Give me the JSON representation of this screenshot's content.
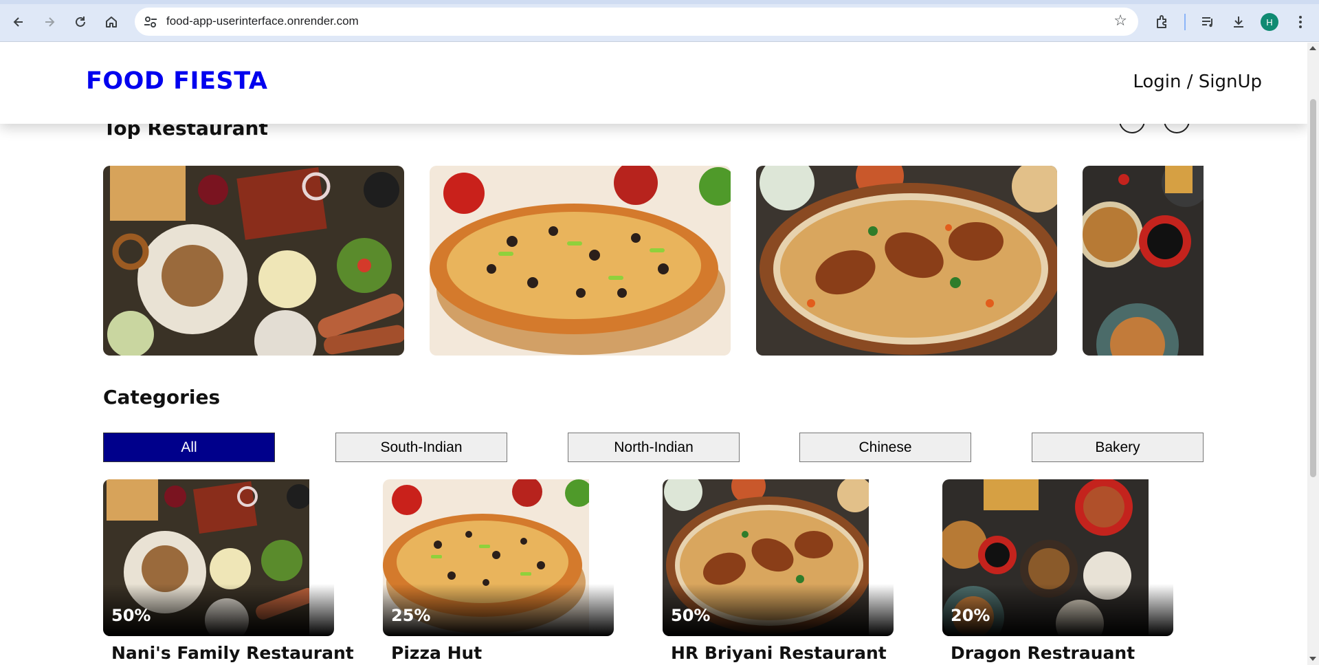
{
  "browser": {
    "url": "food-app-userinterface.onrender.com",
    "profile_initial": "H",
    "icons": [
      "back-icon",
      "forward-icon",
      "reload-icon",
      "home-icon",
      "site-settings-icon",
      "star-icon",
      "extensions-icon",
      "media-icon",
      "download-icon"
    ]
  },
  "header": {
    "brand": "FOOD FIESTA",
    "auth_link": "Login / SignUp",
    "brand_color": "#0000ee"
  },
  "top_restaurant": {
    "title": "Top Restaurant",
    "slides": [
      {
        "image": "assorted-platter"
      },
      {
        "image": "pizza"
      },
      {
        "image": "biryani"
      },
      {
        "image": "asian-dishes"
      }
    ]
  },
  "categories": {
    "title": "Categories",
    "items": [
      {
        "label": "All",
        "active": true
      },
      {
        "label": "South-Indian",
        "active": false
      },
      {
        "label": "North-Indian",
        "active": false
      },
      {
        "label": "Chinese",
        "active": false
      },
      {
        "label": "Bakery",
        "active": false
      }
    ],
    "active_color": "#00008b"
  },
  "restaurants": [
    {
      "name": "Nani's Family Restaurant",
      "offer": "50%",
      "image": "assorted-platter"
    },
    {
      "name": "Pizza Hut",
      "offer": "25%",
      "image": "pizza"
    },
    {
      "name": "HR Briyani Restaurant",
      "offer": "50%",
      "image": "biryani"
    },
    {
      "name": "Dragon Restrauant",
      "offer": "20%",
      "image": "asian-dishes"
    }
  ]
}
